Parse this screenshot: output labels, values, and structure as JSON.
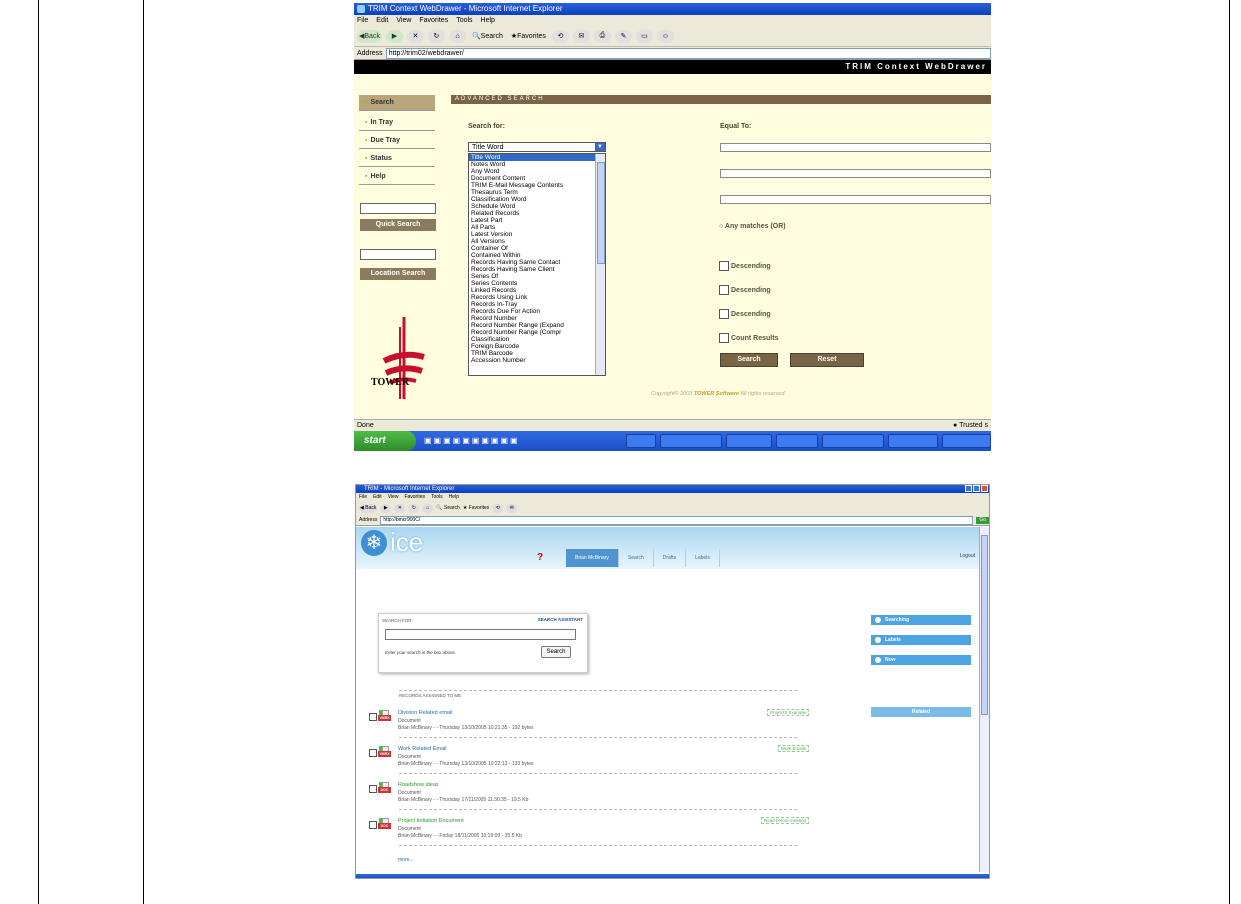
{
  "trim": {
    "window_title": "TRIM Context WebDrawer - Microsoft Internet Explorer",
    "menu": [
      "File",
      "Edit",
      "View",
      "Favorites",
      "Tools",
      "Help"
    ],
    "toolbar": {
      "back": "Back",
      "search": "Search",
      "favorites": "Favorites"
    },
    "address_label": "Address",
    "address": "http://trim02/webdrawer/",
    "banner": "TRIM Context WebDrawer",
    "nav": [
      "Search",
      "In Tray",
      "Due Tray",
      "Status",
      "Help"
    ],
    "quick_search_label": "Quick Search",
    "location_search_label": "Location Search",
    "logo_text": "TOWER",
    "heading": "ADVANCED SEARCH",
    "search_for_label": "Search for:",
    "equal_to_label": "Equal To:",
    "selected_option": "Title Word",
    "options": [
      "Title Word",
      "Notes Word",
      "Any Word",
      "Document Content",
      "TRIM E-Mail Message Contents",
      "Thesaurus Term",
      "Classification Word",
      "Schedule Word",
      "Related Records",
      "Latest Part",
      "All Parts",
      "Latest Version",
      "All Versions",
      "Container Of",
      "Contained Within",
      "Records Having Same Contact",
      "Records Having Same Client",
      "Series Of",
      "Series Contents",
      "Linked Records",
      "Records Using Link",
      "Records In-Tray",
      "Records Due For Action",
      "Record Number",
      "Record Number Range (Expand",
      "Record Number Range (Compr",
      "Classification",
      "Foreign Barcode",
      "TRIM Barcode",
      "Accession Number"
    ],
    "radio_label": "Any matches (OR)",
    "descending": [
      "Descending",
      "Descending",
      "Descending"
    ],
    "count_label": "Count Results",
    "search_btn": "Search",
    "reset_btn": "Reset",
    "copyright_pre": "Copyright© 2003",
    "copyright_brand": "TOWER Software",
    "copyright_post": "All rights reserved.",
    "status_left": "Done",
    "status_right": "Trusted s",
    "start": "start"
  },
  "ice": {
    "window_title": "TRIM - Microsoft Internet Explorer",
    "menu": [
      "File",
      "Edit",
      "View",
      "Favorites",
      "Tools",
      "Help"
    ],
    "toolbar": {
      "back": "Back",
      "search": "Search",
      "favorites": "Favorites"
    },
    "address_label": "Address",
    "address": "http://bmcr900C/",
    "go": "Go",
    "brand": "ice",
    "tabs": [
      "Brian McBinary",
      "Search",
      "Drafts",
      "Labels"
    ],
    "logout": "Logout",
    "search_for_label": "SEARCH FOR:",
    "search_assistant": "SEARCH ASSISTANT",
    "search_hint": "Enter your search in the box above.",
    "search_btn": "Search",
    "side": [
      "Searching",
      "Labels",
      "Now"
    ],
    "related": "Related",
    "records_heading": "RECORDS ASSIGNED TO ME",
    "records": [
      {
        "title": "Division Related email",
        "type": "Document",
        "meta": "Brian McBinary - - Thursday 13/10/2005 10:21:35 - 192 bytes",
        "tag": "VMRX",
        "label": "ProjectX Example",
        "green": false
      },
      {
        "title": "Work Related Email",
        "type": "Document",
        "meta": "Brian McBinary - - Thursday 13/10/2005 10:22:13 - 133 bytes",
        "tag": "VMRX",
        "label": "Work Emails",
        "green": false
      },
      {
        "title": "Roadshow ideas",
        "type": "Document",
        "meta": "Brian McBinary - - Thursday 17/11/2005 11:30:35 - 19.5 Kb",
        "tag": "DOC",
        "label": "",
        "green": true
      },
      {
        "title": "Project Initiation Document",
        "type": "Document",
        "meta": "Brian McBinary - - Friday 18/11/2005 10:19:09 - 35.5 Kb",
        "tag": "DOC",
        "label": "Read before meeting",
        "green": true
      }
    ],
    "more": "more..."
  }
}
